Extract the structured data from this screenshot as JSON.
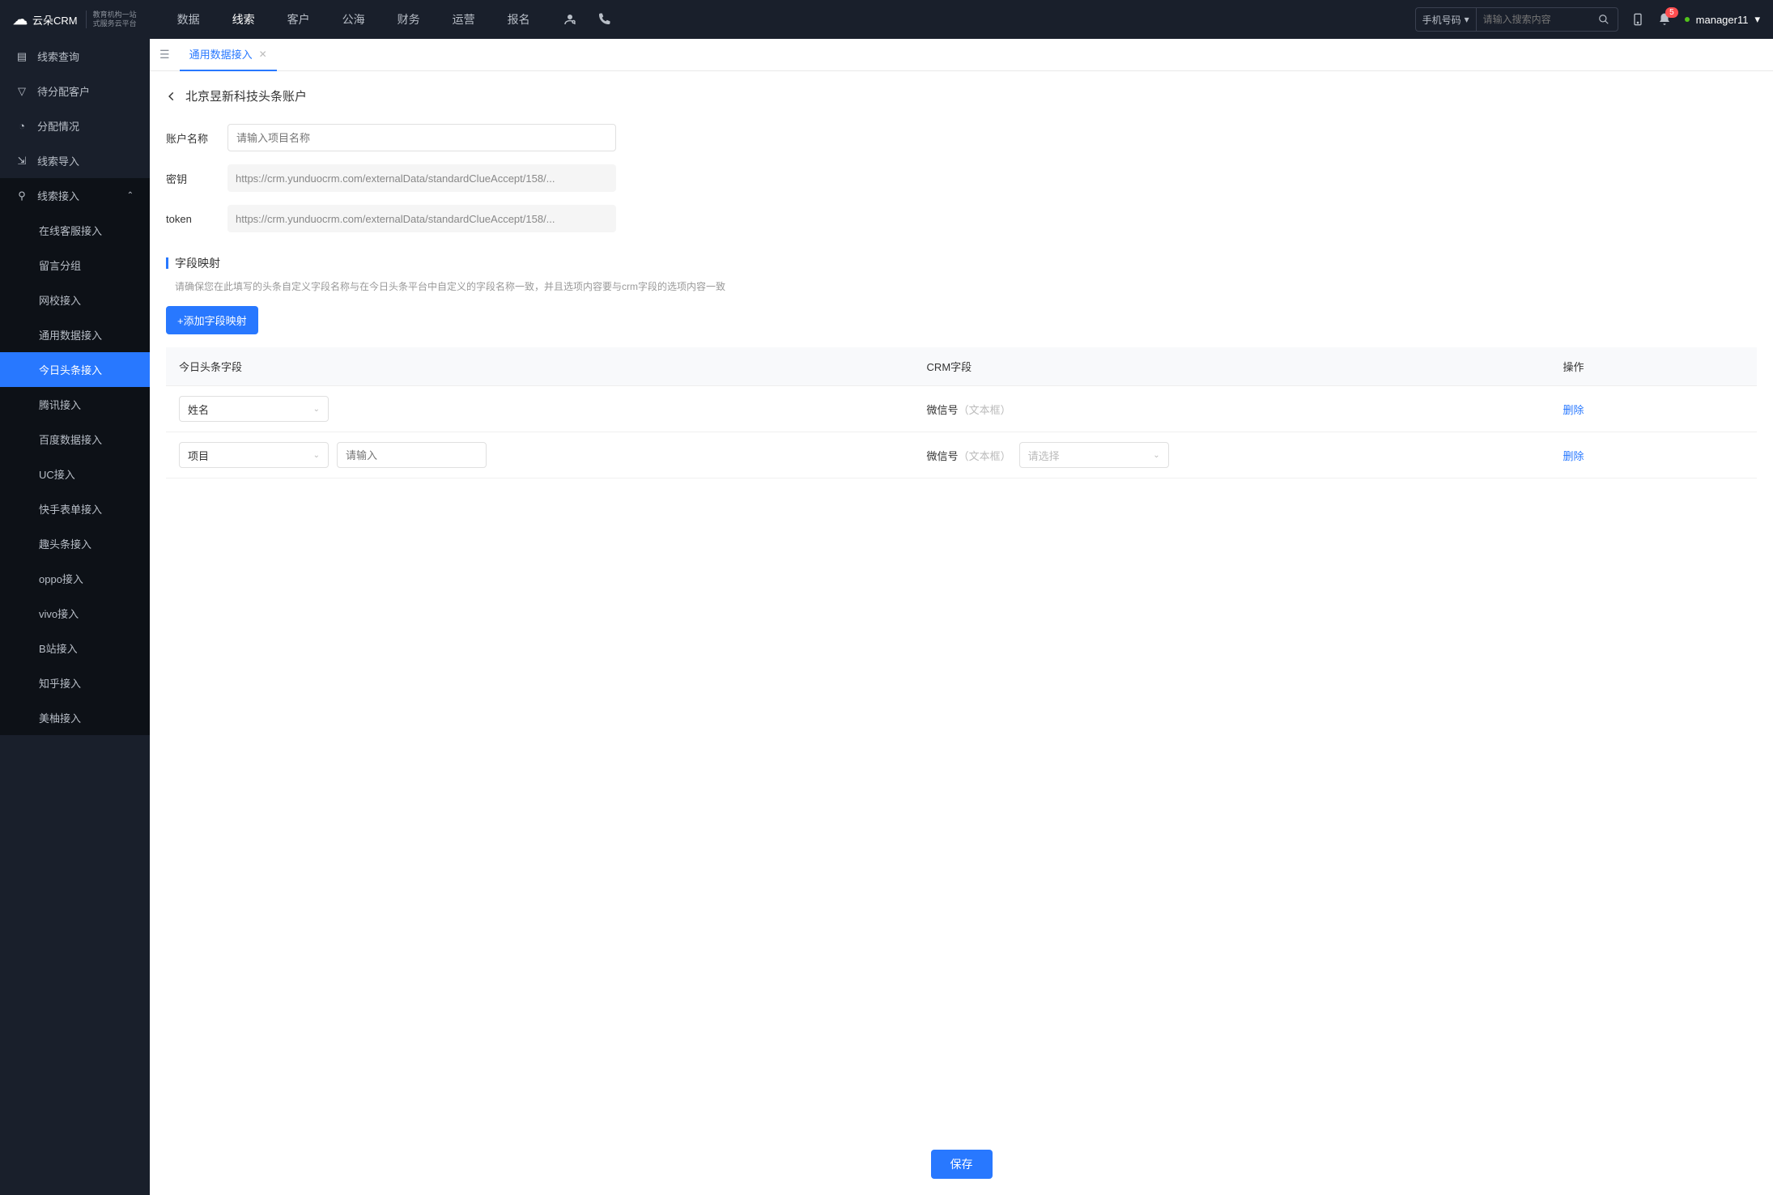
{
  "topnav": {
    "logo_main": "云朵CRM",
    "logo_sub1": "教育机构一站",
    "logo_sub2": "式服务云平台",
    "menu": [
      "数据",
      "线索",
      "客户",
      "公海",
      "财务",
      "运营",
      "报名"
    ],
    "active_index": 1,
    "search_select": "手机号码",
    "search_placeholder": "请输入搜索内容",
    "notif_count": "5",
    "user": "manager11"
  },
  "sidebar": {
    "items": [
      {
        "label": "线索查询"
      },
      {
        "label": "待分配客户"
      },
      {
        "label": "分配情况"
      },
      {
        "label": "线索导入"
      },
      {
        "label": "线索接入",
        "expanded": true
      }
    ],
    "sub": [
      "在线客服接入",
      "留言分组",
      "网校接入",
      "通用数据接入",
      "今日头条接入",
      "腾讯接入",
      "百度数据接入",
      "UC接入",
      "快手表单接入",
      "趣头条接入",
      "oppo接入",
      "vivo接入",
      "B站接入",
      "知乎接入",
      "美柚接入"
    ],
    "sub_active_index": 4
  },
  "tabs": {
    "items": [
      {
        "label": "通用数据接入"
      }
    ]
  },
  "page": {
    "title": "北京昱新科技头条账户",
    "form": {
      "name_label": "账户名称",
      "name_placeholder": "请输入项目名称",
      "secret_label": "密钥",
      "secret_value": "https://crm.yunduocrm.com/externalData/standardClueAccept/158/...",
      "token_label": "token",
      "token_value": "https://crm.yunduocrm.com/externalData/standardClueAccept/158/..."
    },
    "mapping": {
      "title": "字段映射",
      "desc": "请确保您在此填写的头条自定义字段名称与在今日头条平台中自定义的字段名称一致，并且选项内容要与crm字段的选项内容一致",
      "add_btn": "+添加字段映射",
      "columns": {
        "c1": "今日头条字段",
        "c2": "CRM字段",
        "c3": "操作"
      },
      "rows": [
        {
          "field_select": "姓名",
          "extra_input": null,
          "crm_label": "微信号",
          "crm_hint": "（文本框）",
          "crm_select": null,
          "action": "删除"
        },
        {
          "field_select": "项目",
          "extra_input_placeholder": "请输入",
          "crm_label": "微信号",
          "crm_hint": "（文本框）",
          "crm_select_placeholder": "请选择",
          "action": "删除"
        }
      ]
    },
    "save_btn": "保存"
  }
}
